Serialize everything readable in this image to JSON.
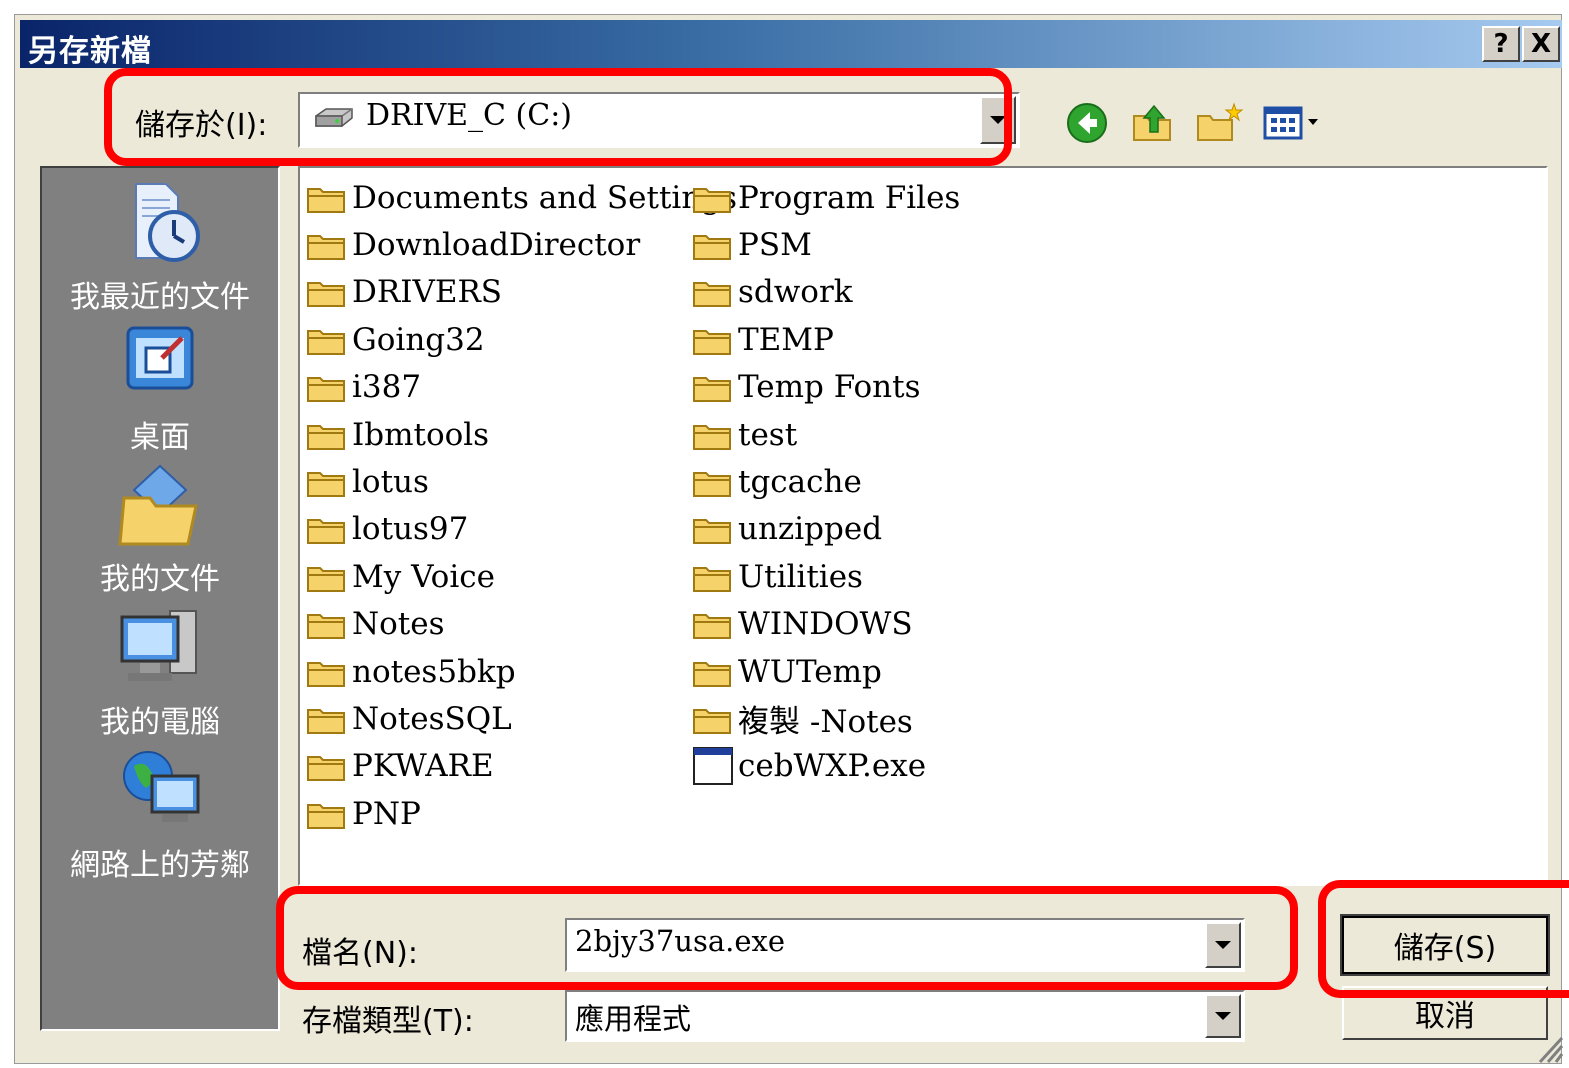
{
  "window": {
    "title": "另存新檔",
    "help_button": "?",
    "close_button": "X"
  },
  "save_in": {
    "label": "儲存於(I):",
    "value": "DRIVE_C (C:)",
    "icon": "drive-icon"
  },
  "toolbar": {
    "icons": [
      "back-icon",
      "up-folder-icon",
      "new-folder-icon",
      "view-menu-icon"
    ]
  },
  "places": [
    {
      "label": "我最近的文件",
      "icon": "recent-documents-icon"
    },
    {
      "label": "桌面",
      "icon": "desktop-icon"
    },
    {
      "label": "我的文件",
      "icon": "my-documents-icon"
    },
    {
      "label": "我的電腦",
      "icon": "my-computer-icon"
    },
    {
      "label": "網路上的芳鄰",
      "icon": "network-places-icon"
    }
  ],
  "files": {
    "column1": [
      "Documents and Settings",
      "DownloadDirector",
      "DRIVERS",
      "Going32",
      "i387",
      "Ibmtools",
      "lotus",
      "lotus97",
      "My Voice",
      "Notes",
      "notes5bkp",
      "NotesSQL",
      "PKWARE",
      "PNP"
    ],
    "column2": [
      "Program Files",
      "PSM",
      "sdwork",
      "TEMP",
      "Temp Fonts",
      "test",
      "tgcache",
      "unzipped",
      "Utilities",
      "WINDOWS",
      "WUTemp",
      "複製 -Notes",
      "cebWXP.exe"
    ]
  },
  "filename": {
    "label": "檔名(N):",
    "value": "2bjy37usa.exe"
  },
  "filetype": {
    "label": "存檔類型(T):",
    "value": "應用程式"
  },
  "buttons": {
    "save": "儲存(S)",
    "cancel": "取消"
  },
  "colors": {
    "highlight": "#ff0000",
    "title_gradient_start": "#0a246a",
    "title_gradient_end": "#a6caf0",
    "places_bar": "#808080",
    "folder": "#f6d36a"
  }
}
